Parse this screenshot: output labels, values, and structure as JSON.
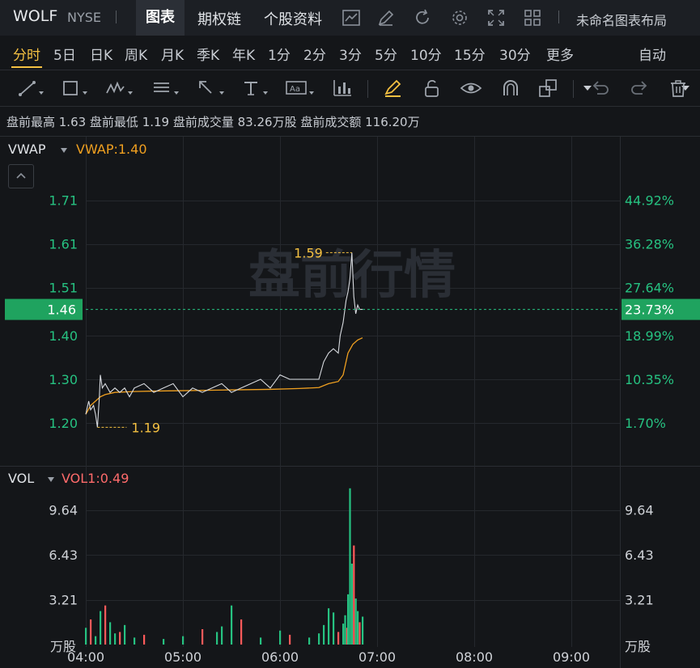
{
  "header": {
    "symbol": "WOLF",
    "exchange": "NYSE",
    "tabs": [
      "图表",
      "期权链",
      "个股资料"
    ],
    "active_tab": "图表",
    "icons": [
      "line-chart-icon",
      "pen-icon",
      "refresh-icon",
      "gear-icon",
      "fullscreen-icon",
      "grid-icon"
    ],
    "layout_label": "未命名图表布局"
  },
  "periods": {
    "items": [
      "分时",
      "5日",
      "日K",
      "周K",
      "月K",
      "季K",
      "年K",
      "1分",
      "2分",
      "3分",
      "5分",
      "10分",
      "15分",
      "30分",
      "更多"
    ],
    "active": "分时",
    "auto_label": "自动"
  },
  "toolbar": {
    "icons": [
      "trendline-icon",
      "rectangle-icon",
      "pattern-icon",
      "fib-icon",
      "arrow-icon",
      "text-icon",
      "label-icon",
      "bars-icon",
      "highlighter-icon",
      "lock-icon",
      "eye-icon",
      "magnet-icon",
      "layers-icon",
      "undo-icon",
      "redo-icon",
      "trash-icon"
    ]
  },
  "stats": {
    "text": "盘前最高 1.63  盘前最低 1.19  盘前成交量 83.26万股  盘前成交额 116.20万"
  },
  "main_pane": {
    "indicator": "VWAP",
    "indicator_value": "VWAP:1.40",
    "watermark": "盘前行情",
    "current_price": "1.46",
    "current_pct": "23.73%"
  },
  "vol_pane": {
    "indicator": "VOL",
    "indicator_value": "VOL1:0.49",
    "unit_left": "万股",
    "unit_right": "万股"
  },
  "colors": {
    "up": "#26c281",
    "down": "#ff5a5a",
    "vwap": "#f0a020",
    "price_line": "#d8dbe0",
    "accent": "#f5c142",
    "price_tag_bg": "#1fa35f"
  },
  "chart_data": [
    {
      "type": "line",
      "pane": "price",
      "x_ticks": [
        "04:00",
        "05:00",
        "06:00",
        "07:00",
        "08:00",
        "09:00"
      ],
      "y_ticks_left": [
        "1.71",
        "1.61",
        "1.51",
        "1.40",
        "1.30",
        "1.20"
      ],
      "y_ticks_right": [
        "44.92%",
        "36.28%",
        "27.64%",
        "18.99%",
        "10.35%",
        "1.70%"
      ],
      "ylim": [
        1.16,
        1.8
      ],
      "annotations": [
        {
          "label": "1.59",
          "x": 6.74,
          "y": 1.59
        },
        {
          "label": "1.19",
          "x": 4.12,
          "y": 1.19
        }
      ],
      "series": [
        {
          "name": "price",
          "x": [
            4.0,
            4.03,
            4.05,
            4.08,
            4.1,
            4.12,
            4.14,
            4.15,
            4.17,
            4.2,
            4.25,
            4.3,
            4.35,
            4.4,
            4.45,
            4.5,
            4.6,
            4.7,
            4.8,
            4.9,
            5.0,
            5.05,
            5.1,
            5.2,
            5.3,
            5.4,
            5.5,
            5.6,
            5.7,
            5.8,
            5.9,
            6.0,
            6.1,
            6.2,
            6.3,
            6.4,
            6.45,
            6.5,
            6.55,
            6.6,
            6.62,
            6.65,
            6.68,
            6.7,
            6.72,
            6.74,
            6.76,
            6.78,
            6.8,
            6.82,
            6.85
          ],
          "values": [
            1.22,
            1.25,
            1.23,
            1.24,
            1.22,
            1.19,
            1.26,
            1.31,
            1.28,
            1.29,
            1.27,
            1.28,
            1.27,
            1.28,
            1.26,
            1.28,
            1.29,
            1.27,
            1.28,
            1.29,
            1.26,
            1.27,
            1.28,
            1.27,
            1.28,
            1.29,
            1.27,
            1.28,
            1.29,
            1.3,
            1.28,
            1.31,
            1.3,
            1.3,
            1.3,
            1.3,
            1.34,
            1.36,
            1.37,
            1.36,
            1.4,
            1.43,
            1.48,
            1.5,
            1.53,
            1.59,
            1.49,
            1.45,
            1.47,
            1.46,
            1.46
          ]
        },
        {
          "name": "VWAP",
          "x": [
            4.0,
            4.05,
            4.1,
            4.15,
            4.2,
            4.3,
            4.5,
            4.7,
            5.0,
            5.3,
            5.6,
            5.9,
            6.2,
            6.4,
            6.5,
            6.6,
            6.65,
            6.7,
            6.75,
            6.8,
            6.85
          ],
          "values": [
            1.22,
            1.24,
            1.25,
            1.26,
            1.265,
            1.27,
            1.272,
            1.273,
            1.274,
            1.275,
            1.276,
            1.277,
            1.279,
            1.281,
            1.29,
            1.295,
            1.31,
            1.36,
            1.38,
            1.39,
            1.395
          ]
        }
      ]
    },
    {
      "type": "bar",
      "pane": "volume",
      "y_ticks": [
        "9.64",
        "6.43",
        "3.21"
      ],
      "ylim": [
        0,
        11.2
      ],
      "x_ticks": [
        "04:00",
        "05:00",
        "06:00",
        "07:00",
        "08:00",
        "09:00"
      ],
      "x": [
        4.0,
        4.05,
        4.1,
        4.15,
        4.2,
        4.25,
        4.3,
        4.35,
        4.4,
        4.5,
        4.6,
        4.8,
        5.0,
        5.2,
        5.35,
        5.4,
        5.5,
        5.6,
        5.8,
        6.0,
        6.1,
        6.3,
        6.4,
        6.45,
        6.5,
        6.55,
        6.6,
        6.65,
        6.67,
        6.69,
        6.7,
        6.72,
        6.74,
        6.76,
        6.78,
        6.8,
        6.82,
        6.85
      ],
      "values": [
        1.2,
        1.8,
        0.6,
        2.4,
        2.8,
        1.6,
        0.8,
        0.9,
        1.4,
        0.5,
        0.7,
        0.4,
        0.6,
        1.1,
        0.9,
        1.3,
        2.8,
        1.8,
        0.5,
        1.0,
        0.7,
        0.5,
        0.8,
        1.4,
        2.6,
        2.3,
        0.9,
        1.5,
        2.1,
        1.2,
        3.6,
        11.2,
        5.8,
        7.1,
        3.3,
        2.4,
        1.6,
        2.0
      ],
      "directions": [
        "up",
        "down",
        "up",
        "up",
        "down",
        "up",
        "up",
        "down",
        "up",
        "up",
        "down",
        "up",
        "up",
        "down",
        "up",
        "up",
        "up",
        "down",
        "up",
        "up",
        "down",
        "up",
        "up",
        "up",
        "up",
        "up",
        "down",
        "up",
        "up",
        "down",
        "up",
        "up",
        "up",
        "down",
        "up",
        "up",
        "down",
        "up"
      ]
    }
  ]
}
